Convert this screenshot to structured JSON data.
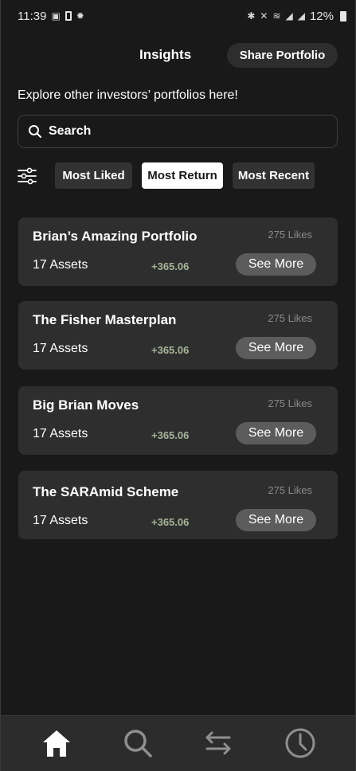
{
  "status_bar": {
    "time": "11:39",
    "left_icons": [
      "image-icon",
      "battery-saver-icon",
      "bug-icon"
    ],
    "right_icons": [
      "bluetooth-icon",
      "mute-icon",
      "wifi-icon",
      "signal-icon",
      "signal-icon"
    ],
    "battery": "12%"
  },
  "header": {
    "title": "Insights",
    "share_label": "Share Portfolio"
  },
  "subtitle": "Explore other investors’ portfolios here!",
  "search": {
    "placeholder": "Search"
  },
  "filters": {
    "icon": "sliders-icon",
    "chips": [
      {
        "label": "Most Liked",
        "active": false
      },
      {
        "label": "Most Return",
        "active": true
      },
      {
        "label": "Most Recent",
        "active": false
      }
    ]
  },
  "portfolios": [
    {
      "title": "Brian’s Amazing Portfolio",
      "likes": "275 Likes",
      "assets": "17 Assets",
      "return": "+365.06",
      "button": "See More"
    },
    {
      "title": "The Fisher Masterplan",
      "likes": "275 Likes",
      "assets": "17 Assets",
      "return": "+365.06",
      "button": "See More"
    },
    {
      "title": "Big Brian Moves",
      "likes": "275 Likes",
      "assets": "17 Assets",
      "return": "+365.06",
      "button": "See More"
    },
    {
      "title": "The SARAmid Scheme",
      "likes": "275 Likes",
      "assets": "17 Assets",
      "return": "+365.06",
      "button": "See More"
    }
  ],
  "bottom_nav": {
    "items": [
      {
        "icon": "home-icon",
        "active": true
      },
      {
        "icon": "search-icon",
        "active": false
      },
      {
        "icon": "swap-arrows-icon",
        "active": false
      },
      {
        "icon": "clock-icon",
        "active": false
      }
    ]
  },
  "colors": {
    "background": "#1a1919",
    "card": "#2f2e2e",
    "chip": "#333232",
    "active_chip": "#ffffff",
    "return_green": "#a7b59a",
    "see_more": "#5d5c5c",
    "nav_bar": "#2d2c2c",
    "nav_inactive": "#8f8f8f"
  }
}
